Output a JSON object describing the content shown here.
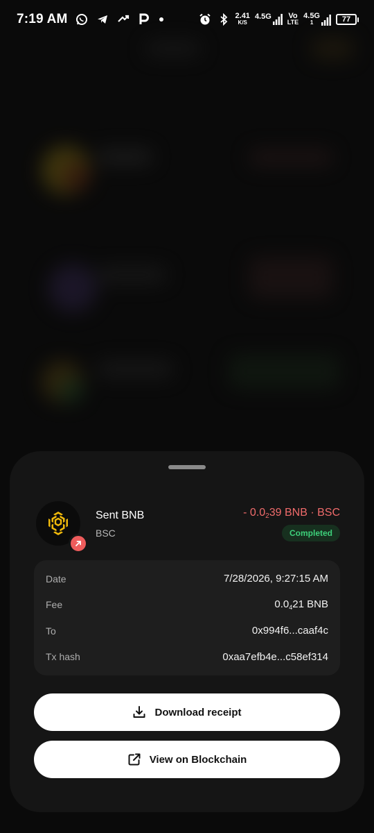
{
  "status_bar": {
    "time": "7:19 AM",
    "left_icons": [
      "whatsapp-icon",
      "telegram-icon",
      "swap-icon",
      "parking-p-icon",
      "dot-icon"
    ],
    "net_speed_value": "2.41",
    "net_speed_unit": "K/S",
    "net1_top": "4.5G",
    "volte_top": "Vo",
    "volte_bottom": "LTE",
    "net2_top": "4.5G",
    "net2_bottom": "1",
    "battery": "77"
  },
  "transaction": {
    "title": "Sent BNB",
    "network": "BSC",
    "amount_prefix": "- 0.0",
    "amount_sub": "2",
    "amount_suffix": "39 BNB · BSC",
    "status": "Completed",
    "token_icon": "bnb-logo-icon",
    "direction_icon": "arrow-up-right-icon"
  },
  "details": {
    "date_label": "Date",
    "date_value": "7/28/2026, 9:27:15 AM",
    "fee_label": "Fee",
    "fee_prefix": "0.0",
    "fee_sub": "4",
    "fee_suffix": "21 BNB",
    "to_label": "To",
    "to_value": "0x994f6...caaf4c",
    "hash_label": "Tx hash",
    "hash_value": "0xaa7efb4e...c58ef314"
  },
  "actions": {
    "download_label": "Download receipt",
    "blockchain_label": "View on Blockchain"
  },
  "colors": {
    "sheet_bg": "#151515",
    "detail_card_bg": "#1e1e1e",
    "negative_amount": "#f06b6b",
    "completed_text": "#3dd07a",
    "completed_bg": "#17301f",
    "direction_badge": "#ee5c5c",
    "bnb_yellow": "#f0b90b"
  }
}
